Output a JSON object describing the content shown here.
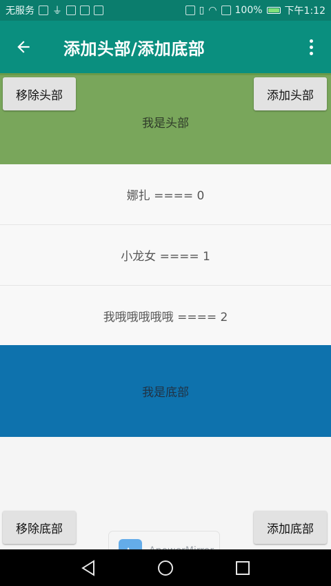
{
  "status_bar": {
    "carrier": "无服务",
    "battery": "100%",
    "time": "下午1:12",
    "icons": [
      "photo-icon",
      "usb-icon",
      "weibo-icon",
      "location-icon",
      "calendar-icon",
      "cast-icon",
      "vibrate-icon",
      "wifi-icon",
      "sim-icon",
      "battery-icon"
    ]
  },
  "toolbar": {
    "title": "添加头部/添加底部",
    "back_icon": "arrow-left-icon",
    "more_icon": "more-vert-icon"
  },
  "header": {
    "label": "我是头部",
    "remove_button": "移除头部",
    "add_button": "添加头部",
    "color": "#79a65b"
  },
  "list": {
    "items": [
      "娜扎 ==== 0",
      "小龙女 ==== 1",
      "我哦哦哦哦哦 ==== 2"
    ]
  },
  "footer": {
    "label": "我是底部",
    "remove_button": "移除底部",
    "add_button": "添加底部",
    "color": "#0e72ad"
  },
  "watermark": {
    "text": "ApowerMirror"
  },
  "nav_bar": {
    "icons": [
      "back-triangle-icon",
      "home-circle-icon",
      "recents-square-icon"
    ]
  }
}
